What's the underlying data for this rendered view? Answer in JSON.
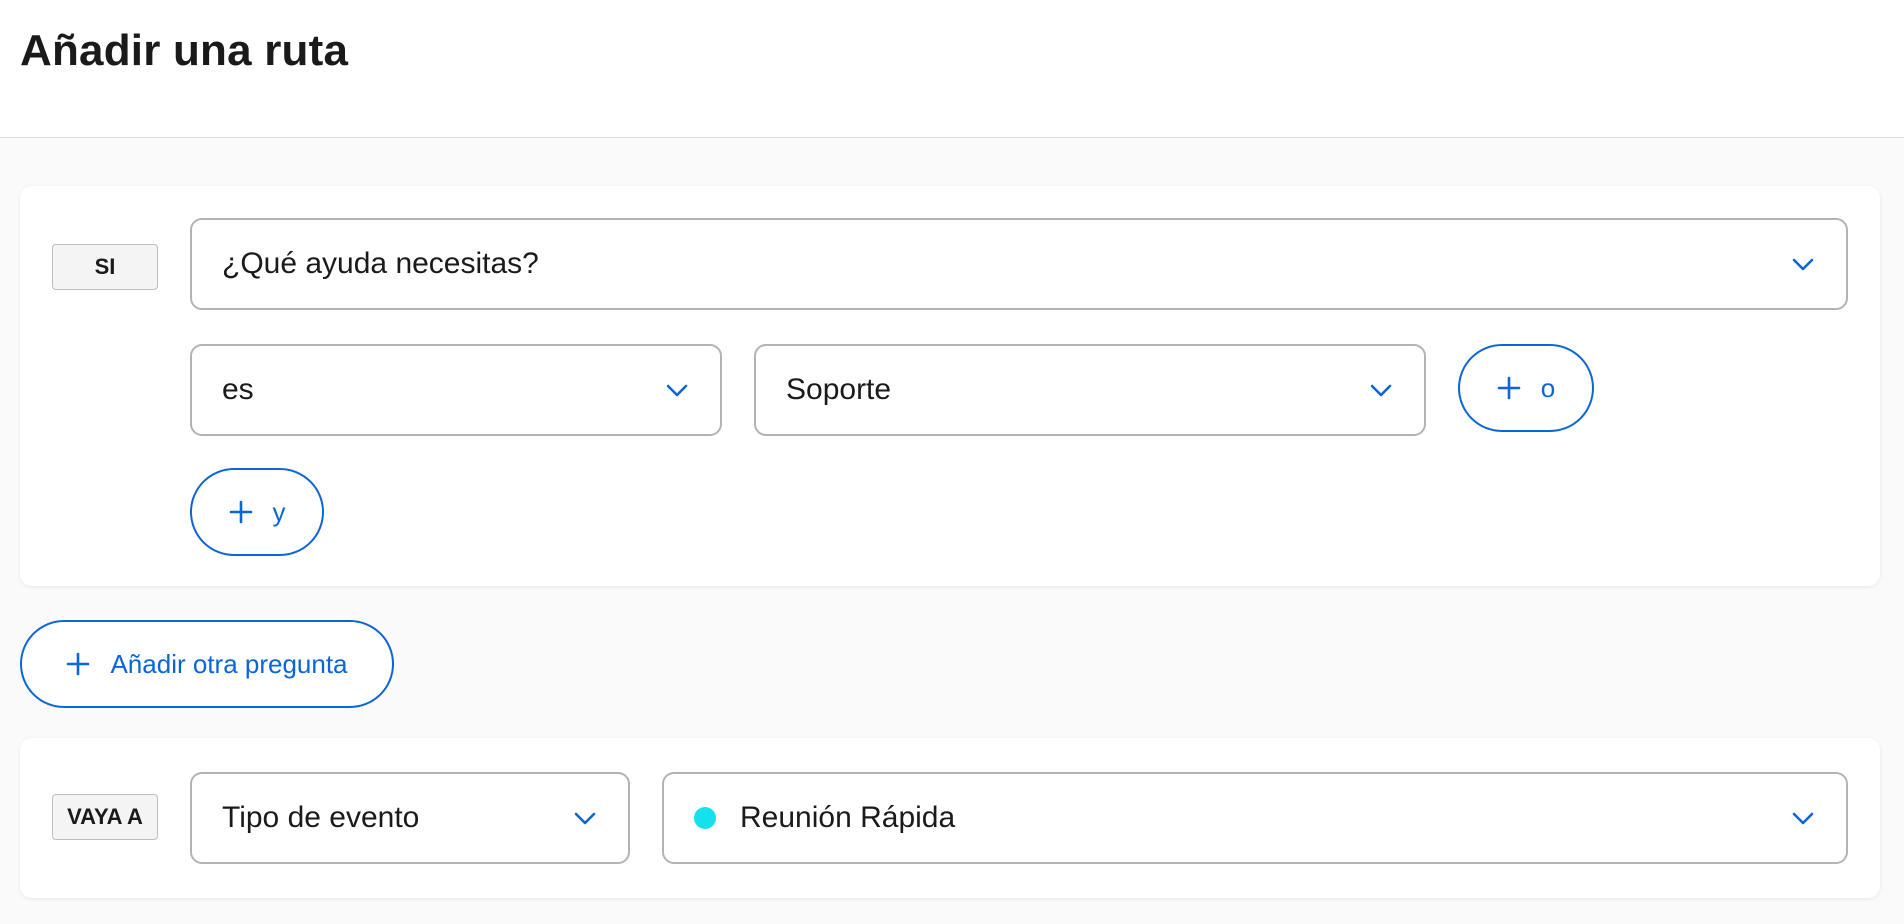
{
  "header": {
    "title": "Añadir una ruta"
  },
  "if_card": {
    "tag": "SI",
    "question": "¿Qué ayuda necesitas?",
    "operator": "es",
    "answer": "Soporte",
    "or_button": "o",
    "and_button": "y"
  },
  "add_question_button": "Añadir otra pregunta",
  "goto_card": {
    "tag": "VAYA A",
    "type_select": "Tipo de evento",
    "event_select": "Reunión Rápida",
    "event_dot_color": "#13e1ec"
  },
  "colors": {
    "accent": "#0a66d8",
    "border": "#b3b3b3"
  },
  "icons": {
    "chevron": "chevron-down-icon",
    "plus": "plus-icon"
  }
}
